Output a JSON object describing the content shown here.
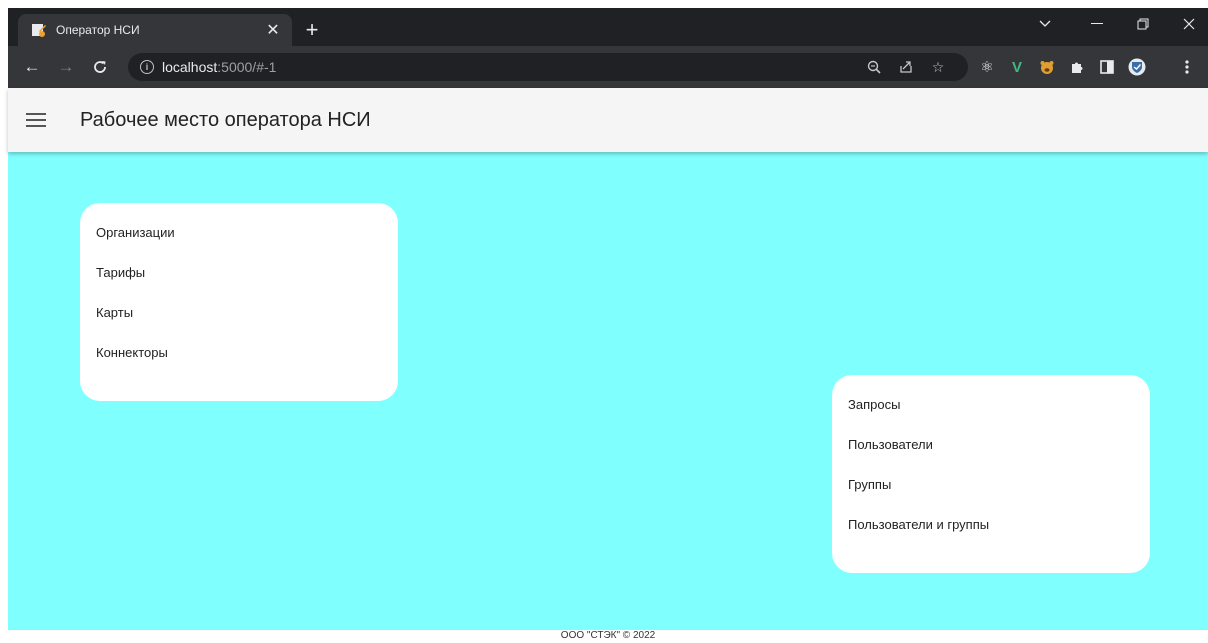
{
  "browser": {
    "tab_title": "Оператор НСИ",
    "url_host": "localhost",
    "url_path": ":5000/#-1",
    "new_tab_label": "+"
  },
  "app": {
    "title": "Рабочее место оператора НСИ",
    "background_color": "#80ffff"
  },
  "left_menu": {
    "items": [
      "Организации",
      "Тарифы",
      "Карты",
      "Коннекторы"
    ]
  },
  "right_menu": {
    "items": [
      "Запросы",
      "Пользователи",
      "Группы",
      "Пользователи и группы"
    ]
  },
  "footer": {
    "text": "ООО \"СТЭК\" © 2022"
  }
}
